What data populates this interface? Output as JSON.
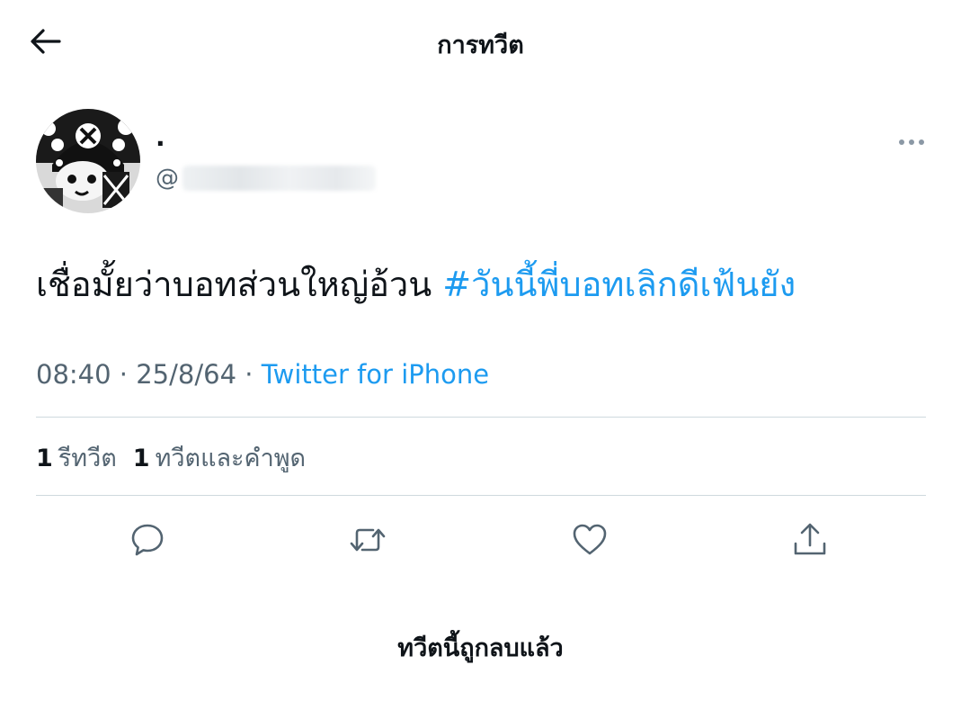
{
  "header": {
    "title": "การทวีต",
    "back_icon": "arrow-left-icon"
  },
  "tweet": {
    "author": {
      "display_name": ".",
      "username_prefix": "@",
      "avatar": "manga-character-avatar"
    },
    "text": "เชื่อมั้ยว่าบอทส่วนใหญ่อ้วน ",
    "hashtag": "#วันนี้พี่บอทเลิกดีเฟ้นยัง",
    "time": "08:40",
    "date": "25/8/64",
    "separator": " · ",
    "source": "Twitter for iPhone"
  },
  "stats": {
    "retweets_count": "1",
    "retweets_label": "รีทวีต",
    "quotes_count": "1",
    "quotes_label": "ทวีตและคำพูด"
  },
  "actions": [
    "reply-icon",
    "retweet-icon",
    "like-icon",
    "share-icon"
  ],
  "footer": {
    "deleted_note": "ทวีตนี้ถูกลบแล้ว"
  },
  "colors": {
    "text_primary": "#0f1419",
    "text_secondary": "#536471",
    "link": "#1d9bf0",
    "divider": "#cfd9de"
  }
}
